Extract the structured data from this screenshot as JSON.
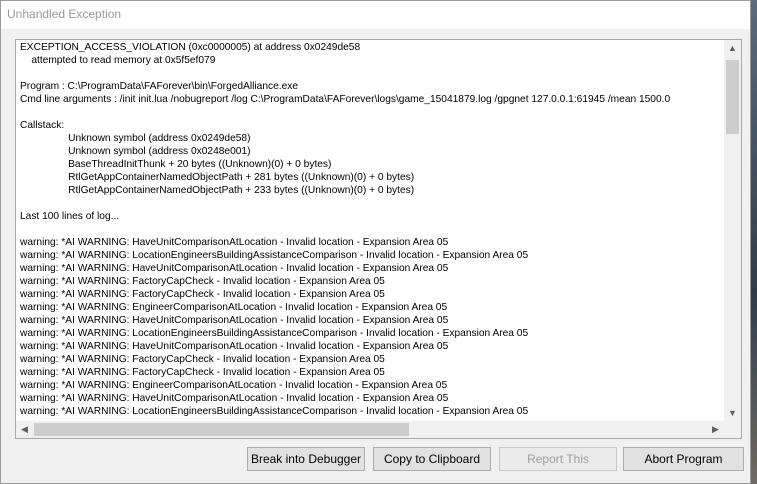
{
  "window": {
    "title": "Unhandled Exception"
  },
  "log": {
    "lines": [
      "EXCEPTION_ACCESS_VIOLATION (0xc0000005) at address 0x0249de58",
      "    attempted to read memory at 0x5f5ef079",
      "",
      "Program : C:\\ProgramData\\FAForever\\bin\\ForgedAlliance.exe",
      "Cmd line arguments : /init init.lua /nobugreport /log C:\\ProgramData\\FAForever\\logs\\game_15041879.log /gpgnet 127.0.0.1:61945 /mean 1500.0",
      "",
      "Callstack:",
      "                 Unknown symbol (address 0x0249de58)",
      "                 Unknown symbol (address 0x0248e001)",
      "                 BaseThreadInitThunk + 20 bytes ((Unknown)(0) + 0 bytes)",
      "                 RtlGetAppContainerNamedObjectPath + 281 bytes ((Unknown)(0) + 0 bytes)",
      "                 RtlGetAppContainerNamedObjectPath + 233 bytes ((Unknown)(0) + 0 bytes)",
      "",
      "Last 100 lines of log...",
      "",
      "warning: *AI WARNING: HaveUnitComparisonAtLocation - Invalid location - Expansion Area 05",
      "warning: *AI WARNING: LocationEngineersBuildingAssistanceComparison - Invalid location - Expansion Area 05",
      "warning: *AI WARNING: HaveUnitComparisonAtLocation - Invalid location - Expansion Area 05",
      "warning: *AI WARNING: FactoryCapCheck - Invalid location - Expansion Area 05",
      "warning: *AI WARNING: FactoryCapCheck - Invalid location - Expansion Area 05",
      "warning: *AI WARNING: EngineerComparisonAtLocation - Invalid location - Expansion Area 05",
      "warning: *AI WARNING: HaveUnitComparisonAtLocation - Invalid location - Expansion Area 05",
      "warning: *AI WARNING: LocationEngineersBuildingAssistanceComparison - Invalid location - Expansion Area 05",
      "warning: *AI WARNING: HaveUnitComparisonAtLocation - Invalid location - Expansion Area 05",
      "warning: *AI WARNING: FactoryCapCheck - Invalid location - Expansion Area 05",
      "warning: *AI WARNING: FactoryCapCheck - Invalid location - Expansion Area 05",
      "warning: *AI WARNING: EngineerComparisonAtLocation - Invalid location - Expansion Area 05",
      "warning: *AI WARNING: HaveUnitComparisonAtLocation - Invalid location - Expansion Area 05",
      "warning: *AI WARNING: LocationEngineersBuildingAssistanceComparison - Invalid location - Expansion Area 05"
    ]
  },
  "buttons": {
    "break_into_debugger": "Break into Debugger",
    "copy_to_clipboard": "Copy to Clipboard",
    "report_this": "Report This",
    "abort_program": "Abort Program"
  },
  "scrollbar": {
    "up_arrow": "▲",
    "down_arrow": "▼",
    "left_arrow": "◀",
    "right_arrow": "▶"
  }
}
